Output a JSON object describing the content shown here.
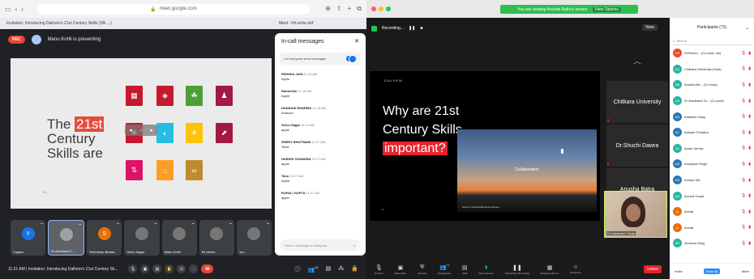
{
  "meet": {
    "url": "meet.google.com",
    "tab_left": "Invitation: Introducing Dalhem's 21st Century Skills (SN ...)",
    "tab_right": "Meet - hfr-snhe-sbf",
    "recording_label": "REC",
    "presenter": "Manu Kohli is presenting",
    "slide": {
      "title_pre": "The",
      "title_hl": "21st",
      "title_rest": "Century Skills are",
      "footer": "01"
    },
    "chat": {
      "title": "In-call messages",
      "toggle_label": "Let everyone send messages",
      "messages": [
        {
          "who": "RISHIKA JAIN",
          "time": "11:15 AM",
          "text": "Apple"
        },
        {
          "who": "Ramkrishi",
          "time": "11:16 AM",
          "text": "Apple"
        },
        {
          "who": "NANDANI SHARMA",
          "time": "11:16 AM",
          "text": "Amazon"
        },
        {
          "who": "Shivu Sagar",
          "time": "11:16 AM",
          "text": "apple"
        },
        {
          "who": "SHREY BHUTWANI",
          "time": "11:17 AM",
          "text": "Tesla"
        },
        {
          "who": "HARSHI CHANDRA",
          "time": "11:17 AM",
          "text": "apple"
        },
        {
          "who": "Tanu",
          "time": "11:17 AM",
          "text": "Apple"
        },
        {
          "who": "RUPALI GUPTA",
          "time": "11:17 AM",
          "text": "apple"
        }
      ],
      "input_placeholder": "Send a message to everyone"
    },
    "thumbs": [
      {
        "name": "Yuganv",
        "initial": "Y",
        "color": "#1a73e8"
      },
      {
        "name": "Dr Aradhana T...",
        "initial": "",
        "color": "#a0a0a0"
      },
      {
        "name": "Snehdeep Bhatia...",
        "initial": "S",
        "color": "#e8710a"
      },
      {
        "name": "Shivu Sagar",
        "initial": "",
        "color": "#777"
      },
      {
        "name": "Manu Kohli",
        "initial": "",
        "color": "#777"
      },
      {
        "name": "94 others",
        "initial": "",
        "color": "#777"
      },
      {
        "name": "You",
        "initial": "",
        "color": "#777"
      }
    ],
    "bottom_info": "11:21 AM  |  Invitation: Introducing Dalhem's 21st Century Sk...",
    "badge_count": "40"
  },
  "zoom": {
    "share_banner": "You are viewing Anusha Batra's screen",
    "view_options": "View Options",
    "recording": "Recording...",
    "view": "View",
    "slide": {
      "brand": "DALHEM",
      "title_1": "Why are 21st",
      "title_2": "Century Skills",
      "title_hl": "important?",
      "image_label": "Collaboration",
      "image_caption": "Source: Harvard Business Review",
      "page": "04"
    },
    "thumbs": [
      "Chitkara University",
      "Dr.Shuchi Dawra",
      "Anusha Batra"
    ],
    "webcam_name": "Dr Aradhana Taluja",
    "toolbar": [
      {
        "label": "Unmute",
        "icon": "mic"
      },
      {
        "label": "Start Video",
        "icon": "video"
      },
      {
        "label": "Security",
        "icon": "shield"
      },
      {
        "label": "Participants",
        "icon": "people"
      },
      {
        "label": "Chat",
        "icon": "chat"
      },
      {
        "label": "Share Screen",
        "icon": "share"
      },
      {
        "label": "Pause/Stop Recording",
        "icon": "pause"
      },
      {
        "label": "Breakout Rooms",
        "icon": "grid"
      },
      {
        "label": "Reactions",
        "icon": "smile"
      }
    ],
    "participants_count": "72",
    "end_label": "Leave",
    "panel": {
      "title": "Participants (72)",
      "search": "Search",
      "rows": [
        {
          "initials": "DS",
          "name": "DrShuchi... (Co-host, me)",
          "color": "#e8492b"
        },
        {
          "initials": "CU",
          "name": "Chitkara University (Host)",
          "color": "#2bb5a0"
        },
        {
          "initials": "AB",
          "name": "Anusha Ba... (Co-host)",
          "color": "#2bb5a0"
        },
        {
          "initials": "DA",
          "name": "Dr Aradhana Ta... (Co-host)",
          "color": "#2bb5a0"
        },
        {
          "initials": "AG",
          "name": "Aakansh Garg",
          "color": "#2a7ab0"
        },
        {
          "initials": "AC",
          "name": "Aakash Chhabra",
          "color": "#2a7ab0"
        },
        {
          "initials": "AV",
          "name": "Aman Verma",
          "color": "#2bb5a0"
        },
        {
          "initials": "AS",
          "name": "Amanjeet Singh",
          "color": "#2a7ab0"
        },
        {
          "initials": "AS",
          "name": "Ameya Sai",
          "color": "#2a7ab0"
        },
        {
          "initials": "AG",
          "name": "Anchal Gupta",
          "color": "#2bb5a0"
        },
        {
          "initials": "A",
          "name": "Anvita",
          "color": "#e8710a"
        },
        {
          "initials": "A",
          "name": "Anvita",
          "color": "#e8710a"
        },
        {
          "initials": "AG",
          "name": "Archana Garg",
          "color": "#2bb5a0"
        }
      ],
      "invite": "Invite",
      "mute_all": "Mute All",
      "more": "More"
    }
  }
}
